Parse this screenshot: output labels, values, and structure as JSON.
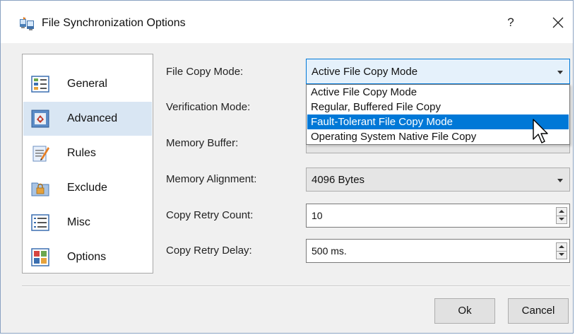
{
  "window": {
    "title": "File Synchronization Options",
    "help_label": "?"
  },
  "sidebar": {
    "items": [
      {
        "label": "General",
        "icon": "general-icon",
        "selected": false
      },
      {
        "label": "Advanced",
        "icon": "advanced-icon",
        "selected": true
      },
      {
        "label": "Rules",
        "icon": "rules-icon",
        "selected": false
      },
      {
        "label": "Exclude",
        "icon": "exclude-lock-icon",
        "selected": false
      },
      {
        "label": "Misc",
        "icon": "misc-list-icon",
        "selected": false
      },
      {
        "label": "Options",
        "icon": "options-icon",
        "selected": false
      }
    ]
  },
  "form": {
    "file_copy_mode": {
      "label": "File Copy Mode:",
      "value": "Active File Copy Mode",
      "options": [
        "Active File Copy Mode",
        "Regular, Buffered File Copy",
        "Fault-Tolerant File Copy Mode",
        "Operating System Native File Copy"
      ],
      "highlighted_option": "Fault-Tolerant File Copy Mode"
    },
    "verification_mode": {
      "label": "Verification Mode:"
    },
    "memory_buffer": {
      "label": "Memory Buffer:"
    },
    "memory_alignment": {
      "label": "Memory Alignment:",
      "value": "4096 Bytes"
    },
    "copy_retry_count": {
      "label": "Copy Retry Count:",
      "value": "10"
    },
    "copy_retry_delay": {
      "label": "Copy Retry Delay:",
      "value": "500 ms."
    }
  },
  "buttons": {
    "ok": "Ok",
    "cancel": "Cancel"
  },
  "colors": {
    "highlight": "#0078d7",
    "selected_sidebar": "#d9e6f3",
    "window_border": "#8aa2c2"
  }
}
